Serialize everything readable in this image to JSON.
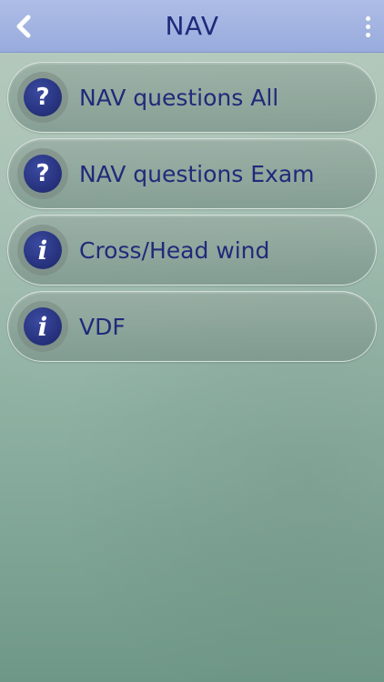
{
  "header": {
    "title": "NAV"
  },
  "menu": {
    "items": [
      {
        "label": "NAV questions All",
        "icon": "question-icon",
        "glyph": "?"
      },
      {
        "label": "NAV questions Exam",
        "icon": "question-icon",
        "glyph": "?"
      },
      {
        "label": "Cross/Head wind",
        "icon": "info-icon",
        "glyph": "i"
      },
      {
        "label": "VDF",
        "icon": "info-icon",
        "glyph": "i"
      }
    ]
  },
  "colors": {
    "header_bg": "#9fb1e0",
    "title_text": "#1f2a7a",
    "icon_circle": "#2a3585"
  }
}
